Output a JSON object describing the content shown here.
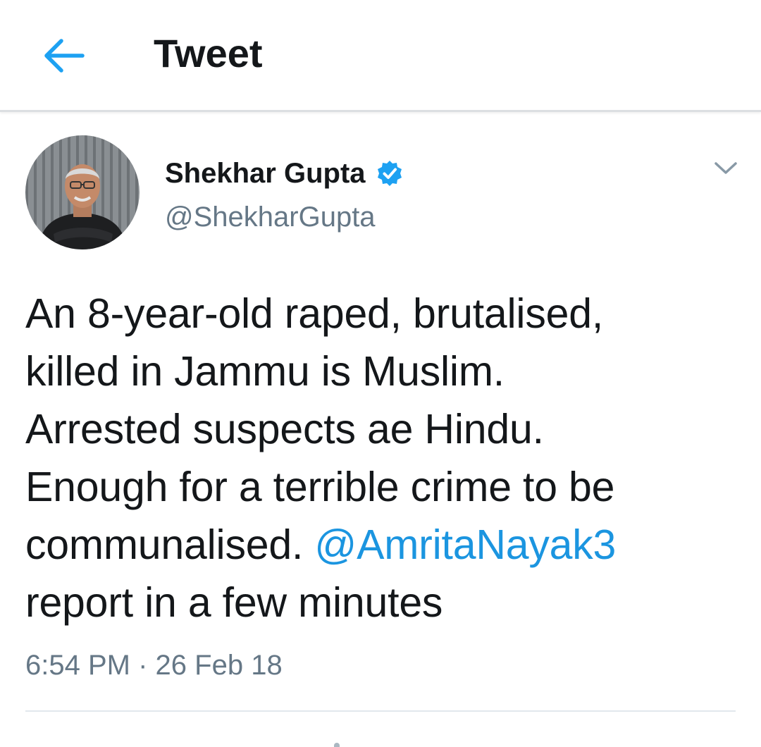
{
  "header": {
    "title": "Tweet",
    "back_icon": "arrow-left-icon",
    "accent_color": "#1da1f2"
  },
  "tweet": {
    "author": {
      "name": "Shekhar Gupta",
      "handle": "@ShekharGupta",
      "verified": true,
      "verified_icon": "verified-badge-icon"
    },
    "menu_icon": "chevron-down-icon",
    "text_lines": [
      "An 8-year-old raped, brutalised,",
      "killed in Jammu is Muslim.",
      "Arrested suspects ae Hindu.",
      "Enough for a terrible crime to be",
      "communalised. ",
      "report in a few minutes"
    ],
    "mention": "@AmritaNayak3",
    "mention_color": "#1b95e0",
    "time": "6:54 PM",
    "separator": "·",
    "date": "26 Feb 18"
  }
}
